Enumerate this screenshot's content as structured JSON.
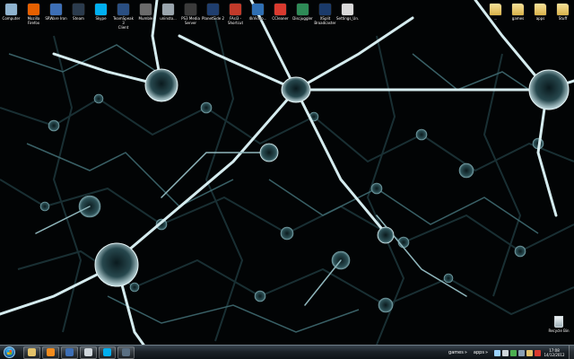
{
  "desktop_icons_left": [
    {
      "label": "Computer",
      "icon": "computer-icon",
      "color": "#8fb3cf"
    },
    {
      "label": "Mozilla\nFirefox",
      "icon": "firefox-icon",
      "color": "#e66000"
    },
    {
      "label": "SRWare Iron",
      "icon": "srware-iron-icon",
      "color": "#3d6fb6"
    },
    {
      "label": "Steam",
      "icon": "steam-icon",
      "color": "#2b3b4d"
    },
    {
      "label": "Skype",
      "icon": "skype-icon",
      "color": "#00aff0"
    },
    {
      "label": "TeamSpeak 3\nClient",
      "icon": "teamspeak-icon",
      "color": "#2a4f82"
    },
    {
      "label": "Mumble",
      "icon": "mumble-icon",
      "color": "#6b6b6b"
    },
    {
      "label": "uninsto...",
      "icon": "uninstaller-icon",
      "color": "#9aa5ad"
    },
    {
      "label": "PS3 Media\nServer",
      "icon": "ps3-media-server-icon",
      "color": "#3b3b3b"
    },
    {
      "label": "PlanetSide 2",
      "icon": "planetside-icon",
      "color": "#1f3e6e"
    },
    {
      "label": "FAsl3 -\nShortcut",
      "icon": "shortcut-icon",
      "color": "#c23a2a"
    },
    {
      "label": "4kVideo...",
      "icon": "video-downloader-icon",
      "color": "#2f6fb3"
    },
    {
      "label": "CCleaner",
      "icon": "ccleaner-icon",
      "color": "#d93a2f"
    },
    {
      "label": "Discjuggler",
      "icon": "discjuggler-icon",
      "color": "#2e8b57"
    },
    {
      "label": "XSplit\nBroadcaster",
      "icon": "xsplit-icon",
      "color": "#1a3a6a"
    },
    {
      "label": "Settings_Un...",
      "icon": "settings-icon",
      "color": "#d9d9d9"
    }
  ],
  "desktop_icons_right": [
    {
      "label": "...",
      "icon": "folder-icon",
      "color": "#e3c26a"
    },
    {
      "label": "games",
      "icon": "folder-icon",
      "color": "#e3c26a"
    },
    {
      "label": "apps",
      "icon": "folder-icon",
      "color": "#e3c26a"
    },
    {
      "label": "Stuff",
      "icon": "folder-icon",
      "color": "#e3c26a"
    }
  ],
  "recycle_bin": {
    "label": "Recycle Bin"
  },
  "taskbar": {
    "pinned": [
      {
        "name": "explorer",
        "icon": "folder-icon",
        "color": "#e3c26a"
      },
      {
        "name": "media-player",
        "icon": "media-player-icon",
        "color": "#f28c1e"
      },
      {
        "name": "browser",
        "icon": "browser-icon",
        "color": "#3d6fb6"
      },
      {
        "name": "app",
        "icon": "app-icon",
        "color": "#cfd6db"
      },
      {
        "name": "skype",
        "icon": "skype-icon",
        "color": "#00aff0"
      },
      {
        "name": "steam",
        "icon": "steam-icon",
        "color": "#5a6f82"
      }
    ],
    "toolbars": [
      {
        "label": "games"
      },
      {
        "label": "apps"
      }
    ],
    "tray_icons": [
      {
        "icon": "network-icon",
        "color": "#9bd3ff"
      },
      {
        "icon": "volume-icon",
        "color": "#cfd6db"
      },
      {
        "icon": "shield-icon",
        "color": "#4caf50"
      },
      {
        "icon": "steam-tray-icon",
        "color": "#8aa0b4"
      },
      {
        "icon": "flag-icon",
        "color": "#e3c26a"
      },
      {
        "icon": "update-icon",
        "color": "#d93a2f"
      }
    ],
    "clock": {
      "time": "17:08",
      "date": "14/12/2012"
    }
  }
}
